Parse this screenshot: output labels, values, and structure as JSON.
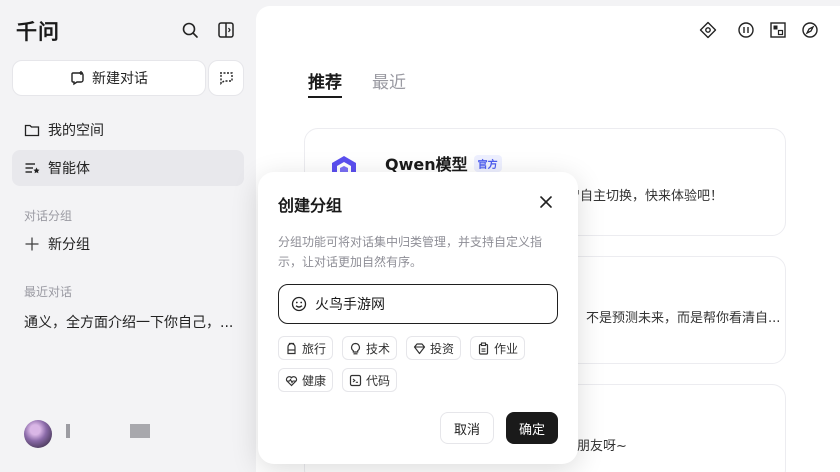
{
  "sidebar": {
    "logo": "千问",
    "new_chat_label": "新建对话",
    "items": [
      {
        "label": "我的空间",
        "icon": "folder-icon"
      },
      {
        "label": "智能体",
        "icon": "agent-list-icon"
      }
    ],
    "group_section_label": "对话分组",
    "add_group_label": "新分组",
    "recent_section_label": "最近对话",
    "recent_items": [
      {
        "label": "通义，全方面介绍一下你自己，..."
      }
    ]
  },
  "main": {
    "tabs": [
      {
        "label": "推荐",
        "active": true
      },
      {
        "label": "最近",
        "active": false
      }
    ],
    "cards": [
      {
        "title": "Qwen模型",
        "badge": "官方",
        "desc": "智自主切换，快来体验吧！"
      },
      {
        "desc": "。不是预测未来，而是帮你看清自..."
      },
      {
        "desc": "朋友呀~"
      }
    ]
  },
  "modal": {
    "title": "创建分组",
    "description": "分组功能可将对话集中归类管理，并支持自定义指示，让对话更加自然有序。",
    "input_value": "火鸟手游网",
    "chips": [
      {
        "label": "旅行",
        "icon": "backpack-icon"
      },
      {
        "label": "技术",
        "icon": "lightbulb-icon"
      },
      {
        "label": "投资",
        "icon": "diamond-icon"
      },
      {
        "label": "作业",
        "icon": "clipboard-icon"
      },
      {
        "label": "健康",
        "icon": "heart-pulse-icon"
      },
      {
        "label": "代码",
        "icon": "code-icon"
      }
    ],
    "cancel_label": "取消",
    "confirm_label": "确定"
  },
  "colors": {
    "sidebar_bg": "#f3f3f5",
    "accent": "#1a1a1a",
    "badge": "#4c5cf0"
  }
}
